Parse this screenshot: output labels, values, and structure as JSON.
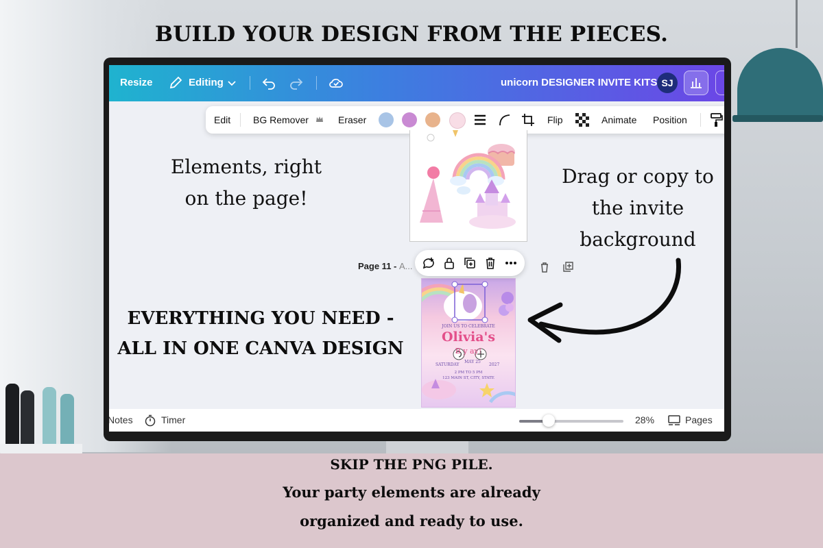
{
  "headline": "BUILD YOUR DESIGN FROM THE PIECES.",
  "topbar": {
    "resize_label": "Resize",
    "editing_label": "Editing",
    "doc_title": "unicorn DESIGNER INVITE KITS",
    "avatar_initials": "SJ"
  },
  "toolbar": {
    "edit_label": "Edit",
    "bg_remover_label": "BG Remover",
    "eraser_label": "Eraser",
    "swatches": [
      "#a8c4e6",
      "#c98ad3",
      "#e8b38c",
      "#f8dde6"
    ],
    "flip_label": "Flip",
    "animate_label": "Animate",
    "position_label": "Position"
  },
  "canvas": {
    "page_label": "Page 11 - ",
    "page_label_suffix": "A..."
  },
  "invite": {
    "line1": "JOIN US TO CELEBRATE",
    "name": "Olivia's",
    "line3": "B   y  ay!",
    "date_left": "SATURDAY",
    "date_mid": "MAY 25",
    "date_right": "2027",
    "line5": "2 PM TO 5 PM",
    "line6": "123 MAIN ST, CITY, STATE"
  },
  "annotations": {
    "left_top_line1": "Elements, right",
    "left_top_line2": "on the page!",
    "right_line1": "Drag or copy to",
    "right_line2": "the invite",
    "right_line3": "background",
    "bold_line1": "EVERYTHING YOU NEED -",
    "bold_line2": "ALL IN ONE CANVA DESIGN"
  },
  "bottombar": {
    "notes_label": "Notes",
    "timer_label": "Timer",
    "zoom_label": "28%",
    "zoom_fraction": 0.28,
    "pages_label": "Pages"
  },
  "footer": {
    "line1": "SKIP THE PNG PILE.",
    "line2": "Your party elements are already",
    "line3": "organized and ready to use."
  }
}
